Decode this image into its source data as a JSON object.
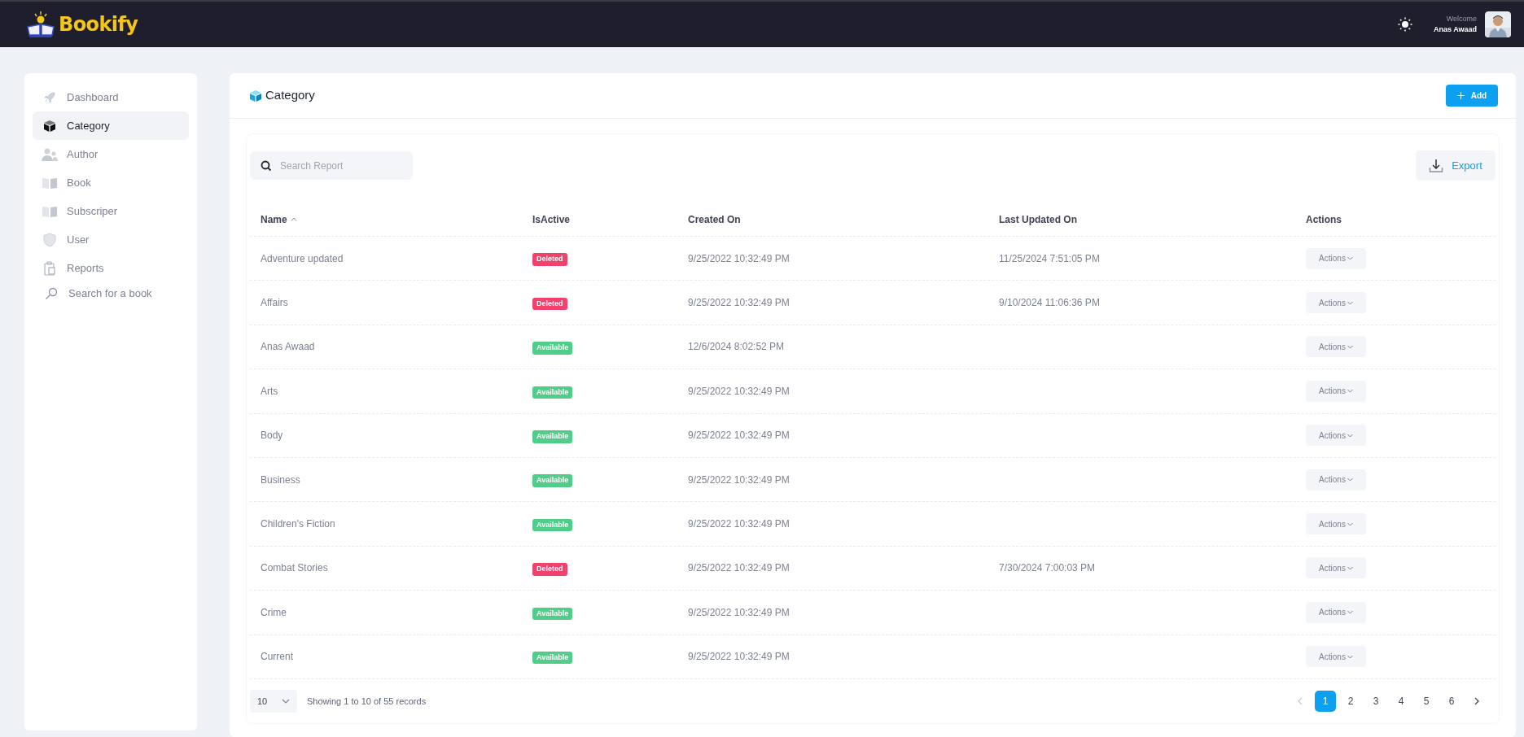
{
  "header": {
    "brand": "Bookify",
    "welcome": "Welcome",
    "user_name": "Anas Awaad"
  },
  "sidebar": {
    "items": [
      {
        "label": "Dashboard",
        "selected": false
      },
      {
        "label": "Category",
        "selected": true
      },
      {
        "label": "Author",
        "selected": false
      },
      {
        "label": "Book",
        "selected": false
      },
      {
        "label": "Subscriper",
        "selected": false
      },
      {
        "label": "User",
        "selected": false
      },
      {
        "label": "Reports",
        "selected": false
      },
      {
        "label": "Search for a book",
        "selected": false
      }
    ]
  },
  "page": {
    "title": "Category",
    "add_button": "Add"
  },
  "toolbar": {
    "search": {
      "placeholder": "Search Report"
    },
    "export_button": "Export"
  },
  "table": {
    "columns": [
      {
        "label": "Name",
        "sorted": true
      },
      {
        "label": "IsActive"
      },
      {
        "label": "Created On"
      },
      {
        "label": "Last Updated On"
      },
      {
        "label": "Actions"
      }
    ],
    "rows": [
      {
        "name": "Adventure updated",
        "status": {
          "label": "Deleted",
          "kind": "deleted"
        },
        "created_on": "9/25/2022 10:32:49 PM",
        "last_updated_on": "11/25/2024 7:51:05 PM",
        "actions": "Actions"
      },
      {
        "name": "Affairs",
        "status": {
          "label": "Deleted",
          "kind": "deleted"
        },
        "created_on": "9/25/2022 10:32:49 PM",
        "last_updated_on": "9/10/2024 11:06:36 PM",
        "actions": "Actions"
      },
      {
        "name": "Anas Awaad",
        "status": {
          "label": "Available",
          "kind": "available"
        },
        "created_on": "12/6/2024 8:02:52 PM",
        "actions": "Actions"
      },
      {
        "name": "Arts",
        "status": {
          "label": "Available",
          "kind": "available"
        },
        "created_on": "9/25/2022 10:32:49 PM",
        "actions": "Actions"
      },
      {
        "name": "Body",
        "status": {
          "label": "Available",
          "kind": "available"
        },
        "created_on": "9/25/2022 10:32:49 PM",
        "actions": "Actions"
      },
      {
        "name": "Business",
        "status": {
          "label": "Available",
          "kind": "available"
        },
        "created_on": "9/25/2022 10:32:49 PM",
        "actions": "Actions"
      },
      {
        "name": "Children's Fiction",
        "status": {
          "label": "Available",
          "kind": "available"
        },
        "created_on": "9/25/2022 10:32:49 PM",
        "actions": "Actions"
      },
      {
        "name": "Combat Stories",
        "status": {
          "label": "Deleted",
          "kind": "deleted"
        },
        "created_on": "9/25/2022 10:32:49 PM",
        "last_updated_on": "7/30/2024 7:00:03 PM",
        "actions": "Actions"
      },
      {
        "name": "Crime",
        "status": {
          "label": "Available",
          "kind": "available"
        },
        "created_on": "9/25/2022 10:32:49 PM",
        "actions": "Actions"
      },
      {
        "name": "Current",
        "status": {
          "label": "Available",
          "kind": "available"
        },
        "created_on": "9/25/2022 10:32:49 PM",
        "actions": "Actions"
      }
    ]
  },
  "footer": {
    "page_size": "10",
    "summary": "Showing 1 to 10 of 55 records",
    "previous_disabled": true,
    "pages": [
      {
        "label": "1",
        "selected": true
      },
      {
        "label": "2",
        "selected": false
      },
      {
        "label": "3",
        "selected": false
      },
      {
        "label": "4",
        "selected": false
      },
      {
        "label": "5",
        "selected": false
      },
      {
        "label": "6",
        "selected": false
      }
    ]
  }
}
